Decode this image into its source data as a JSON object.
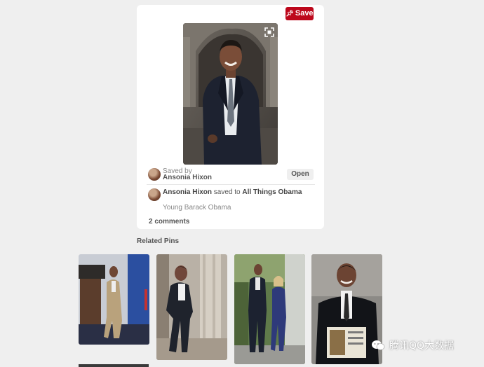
{
  "pin": {
    "save_label": "Save",
    "saved_by_label": "Saved by",
    "saved_by_name": "Ansonia Hixon",
    "open_label": "Open",
    "activity": {
      "user": "Ansonia Hixon",
      "verb": "saved to",
      "board": "All Things Obama"
    },
    "board_description": "Young Barack Obama",
    "comments": "2 comments"
  },
  "related": {
    "title": "Related Pins",
    "pins": [
      {
        "name": "related-pin-1"
      },
      {
        "name": "related-pin-2"
      },
      {
        "name": "related-pin-3"
      },
      {
        "name": "related-pin-4"
      }
    ]
  },
  "watermark": {
    "text": "腾讯QQ大数据"
  },
  "colors": {
    "save_red": "#bd081c",
    "page_bg": "#efefef"
  }
}
